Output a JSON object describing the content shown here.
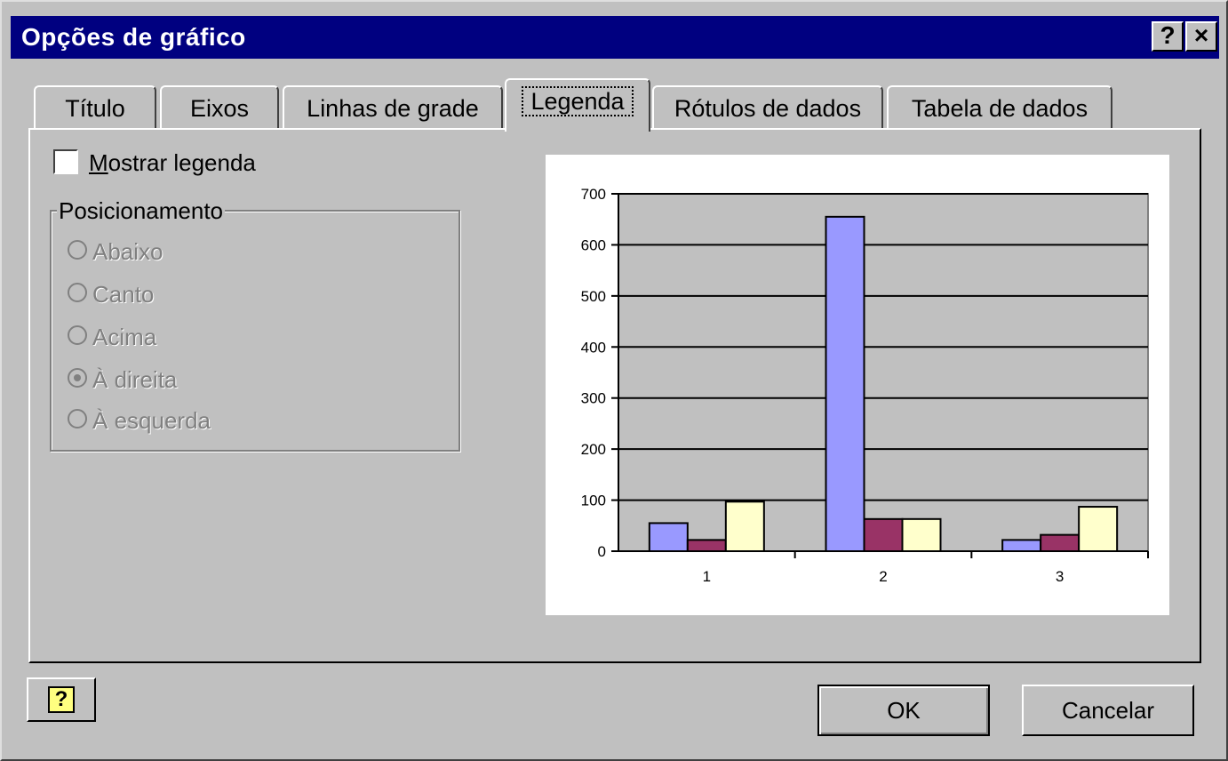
{
  "window": {
    "title": "Opções de gráfico",
    "help_glyph": "?",
    "close_glyph": "×"
  },
  "tabs": [
    {
      "label": "Título"
    },
    {
      "label": "Eixos"
    },
    {
      "label": "Linhas de grade"
    },
    {
      "label": "Legenda"
    },
    {
      "label": "Rótulos de dados"
    },
    {
      "label": "Tabela de dados"
    }
  ],
  "active_tab": "Legenda",
  "legend": {
    "show_prefix": "M",
    "show_rest": "ostrar legenda",
    "show_checked": false,
    "position_group": "Posicionamento",
    "positions": [
      "Abaixo",
      "Canto",
      "Acima",
      "À direita",
      "À esquerda"
    ],
    "selected_position": "À direita",
    "positions_enabled": false
  },
  "buttons": {
    "ok": "OK",
    "cancel": "Cancelar",
    "help_icon": "question-mark-icon",
    "help_glyph": "?"
  },
  "chart_data": {
    "type": "bar",
    "categories": [
      "1",
      "2",
      "3"
    ],
    "series": [
      {
        "values": [
          55,
          655,
          22
        ],
        "color": "#9999ff"
      },
      {
        "values": [
          22,
          63,
          32
        ],
        "color": "#993366"
      },
      {
        "values": [
          97,
          63,
          87
        ],
        "color": "#ffffcc"
      }
    ],
    "ylim": [
      0,
      700
    ],
    "yticks": [
      "0",
      "100",
      "200",
      "300",
      "400",
      "500",
      "600",
      "700"
    ],
    "plot_area_color": "#c0c0c0",
    "grid": true,
    "legend": false
  }
}
